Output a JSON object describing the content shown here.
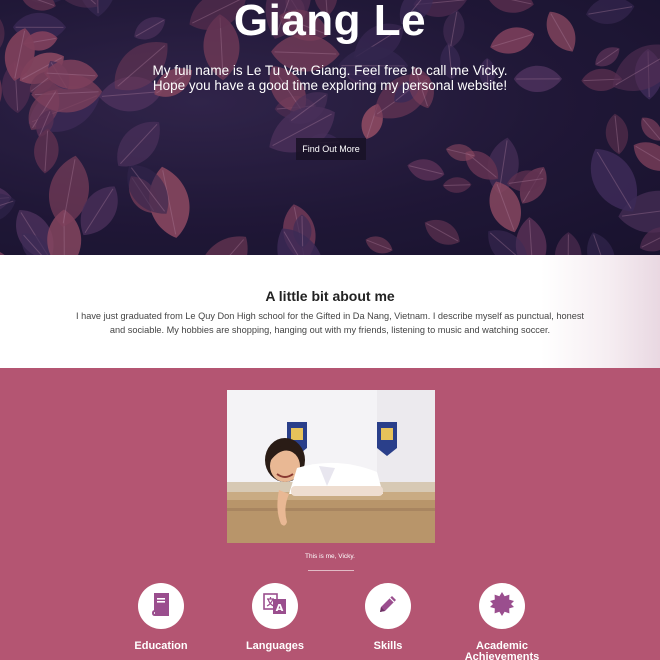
{
  "hero": {
    "title": "Giang Le",
    "subtitle_line1": "My full name is Le Tu Van Giang. Feel free to call me Vicky.",
    "subtitle_line2": "Hope you have a good time exploring my personal website!",
    "button_label": "Find Out More"
  },
  "about": {
    "title": "A little bit about me",
    "text_line1": "I have just graduated from Le Quy Don High school for the Gifted in Da Nang, Vietnam. I describe myself as punctual, honest",
    "text_line2": "and sociable. My hobbies are shopping, hanging out with my friends, listening to music and watching soccer."
  },
  "photo": {
    "caption": "This is me, Vicky."
  },
  "features": [
    {
      "label": "Education",
      "icon": "book-icon"
    },
    {
      "label": "Languages",
      "icon": "translate-icon"
    },
    {
      "label": "Skills",
      "icon": "pencil-icon"
    },
    {
      "label": "Academic Achievements",
      "icon": "badge-icon"
    }
  ],
  "colors": {
    "accent": "#b45572",
    "hero_dark": "#241a3c"
  }
}
